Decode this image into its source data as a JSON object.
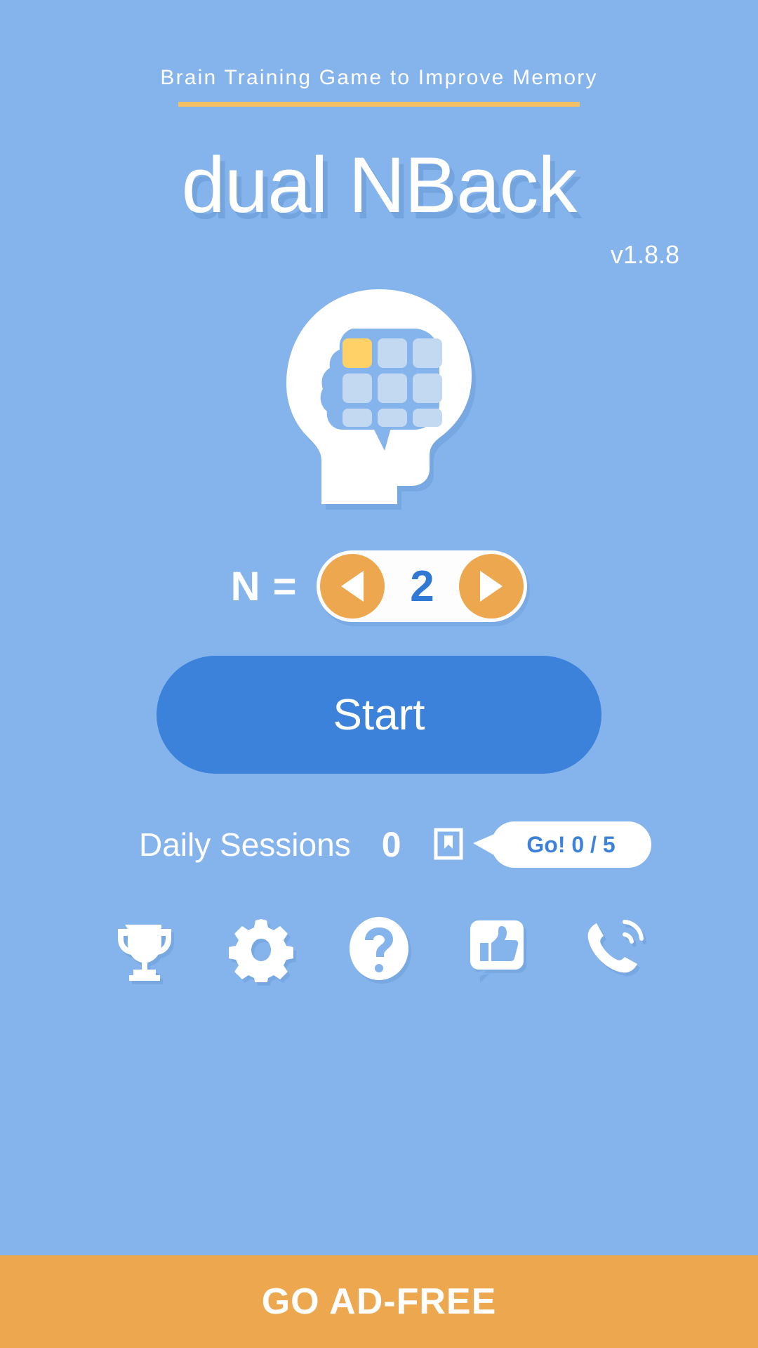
{
  "app": {
    "tagline": "Brain Training Game to Improve Memory",
    "title": "dual NBack",
    "version": "v1.8.8",
    "accent_orange": "#eda84f",
    "accent_blue": "#3c82da",
    "background": "#85b4ec",
    "rule_color": "#f5c063"
  },
  "logo": {
    "name": "brain-head-logo",
    "grid_rows": 3,
    "grid_cols": 3,
    "highlighted_cell_index": 0,
    "highlight_color": "#ffd166",
    "cell_color": "#c3d9f2"
  },
  "n_selector": {
    "label": "N =",
    "value": "2",
    "decrease_icon": "triangle-left-icon",
    "increase_icon": "triangle-right-icon"
  },
  "start": {
    "label": "Start"
  },
  "daily": {
    "label": "Daily Sessions",
    "count": "0",
    "mark_icon": "bookmark-square-icon",
    "goal_text": "Go! 0 / 5"
  },
  "icons": [
    {
      "name": "trophy-icon",
      "label": "Achievements"
    },
    {
      "name": "gear-icon",
      "label": "Settings"
    },
    {
      "name": "question-mark-icon",
      "label": "Help"
    },
    {
      "name": "thumbs-up-icon",
      "label": "Rate"
    },
    {
      "name": "phone-icon",
      "label": "Contact"
    }
  ],
  "ad_banner": {
    "label": "GO AD-FREE"
  }
}
